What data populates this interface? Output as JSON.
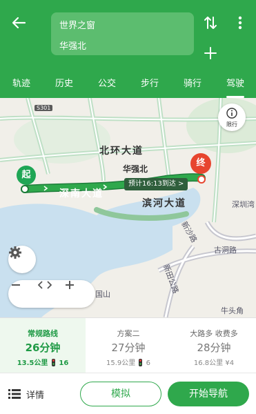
{
  "header": {
    "origin": "世界之窗",
    "destination": "华强北",
    "icons": {
      "back": "back-arrow-icon",
      "swap": "swap-icon",
      "more": "more-vertical-icon",
      "add": "add-icon"
    }
  },
  "tabs": [
    {
      "label": "轨迹",
      "active": false
    },
    {
      "label": "历史",
      "active": false
    },
    {
      "label": "公交",
      "active": false
    },
    {
      "label": "步行",
      "active": false
    },
    {
      "label": "骑行",
      "active": false
    },
    {
      "label": "驾驶",
      "active": true
    }
  ],
  "map": {
    "highway_shield": "S301",
    "labels": {
      "beihuan": "北环大道",
      "huaqiangbei": "华强北",
      "shennan": "深南大道",
      "binhe": "滨河大道",
      "shenzhenwan": "深圳湾",
      "xinsha": "新沙路",
      "gudong": "古洞路",
      "xintian": "新田公路",
      "guoshan": "国山",
      "niutoujiao": "牛头角"
    },
    "traffic_label": "限行",
    "start_pin": "起",
    "end_pin": "终",
    "eta": "预计16:13到达 >",
    "colors": {
      "route": "#2fa84c",
      "route_dark": "#2f5f3c",
      "water": "#c9e0ef",
      "green_area": "#cfe6cf"
    }
  },
  "options": [
    {
      "label": "常规路线",
      "time": "26分钟",
      "distance": "13.5公里",
      "extra": "16",
      "active": true
    },
    {
      "label": "方案二",
      "time": "27分钟",
      "distance": "15.9公里",
      "extra": "6",
      "active": false
    },
    {
      "label": "大路多 收费多",
      "time": "28分钟",
      "distance": "16.8公里",
      "extra": "¥4",
      "active": false
    }
  ],
  "bottom": {
    "detail": "详情",
    "simulate": "模拟",
    "start_nav": "开始导航"
  },
  "colors": {
    "brand": "#2fa84c",
    "accent_light": "#eef8ee",
    "end_marker": "#e7452f"
  }
}
